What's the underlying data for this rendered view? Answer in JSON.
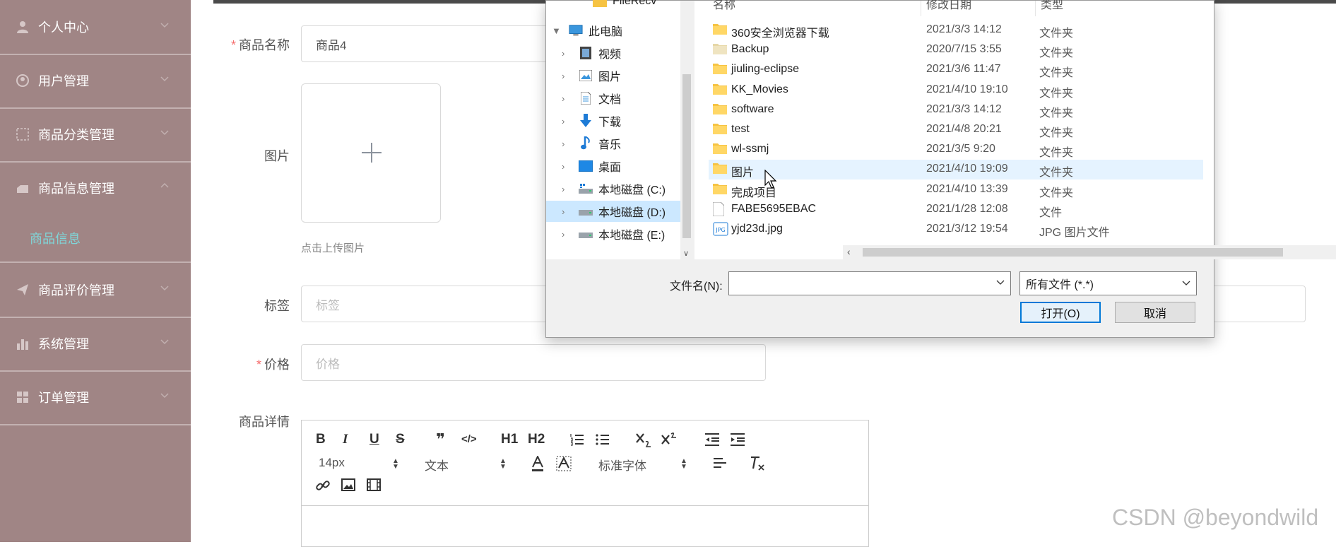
{
  "sidebar": {
    "items": [
      {
        "label": "个人中心",
        "icon": "user-icon"
      },
      {
        "label": "用户管理",
        "icon": "users-icon"
      },
      {
        "label": "商品分类管理",
        "icon": "category-icon"
      },
      {
        "label": "商品信息管理",
        "icon": "product-icon"
      },
      {
        "label": "商品评价管理",
        "icon": "review-icon"
      },
      {
        "label": "系统管理",
        "icon": "chart-icon"
      },
      {
        "label": "订单管理",
        "icon": "order-icon"
      }
    ],
    "active_sub": "商品信息"
  },
  "form": {
    "name_label": "商品名称",
    "name_value": "商品4",
    "image_label": "图片",
    "upload_hint": "点击上传图片",
    "tag_label": "标签",
    "tag_placeholder": "标签",
    "price_label": "价格",
    "price_placeholder": "价格",
    "detail_label": "商品详情"
  },
  "editor": {
    "font_size": "14px",
    "block_type": "文本",
    "font_family": "标准字体",
    "buttons": [
      "B",
      "I",
      "U",
      "S",
      "❞",
      "</>",
      "H1",
      "H2"
    ]
  },
  "dialog": {
    "tree_top": "FileRecv",
    "columns": {
      "name": "名称",
      "date": "修改日期",
      "type": "类型"
    },
    "tree": [
      {
        "label": "此电脑",
        "icon": "computer-icon"
      },
      {
        "label": "视频",
        "icon": "video-icon"
      },
      {
        "label": "图片",
        "icon": "picture-icon"
      },
      {
        "label": "文档",
        "icon": "document-icon"
      },
      {
        "label": "下载",
        "icon": "download-icon"
      },
      {
        "label": "音乐",
        "icon": "music-icon"
      },
      {
        "label": "桌面",
        "icon": "desktop-icon"
      },
      {
        "label": "本地磁盘 (C:)",
        "icon": "drive-icon"
      },
      {
        "label": "本地磁盘 (D:)",
        "icon": "drive-icon"
      },
      {
        "label": "本地磁盘 (E:)",
        "icon": "drive-icon"
      }
    ],
    "files": [
      {
        "name": "360安全浏览器下载",
        "date": "2021/3/3 14:12",
        "type": "文件夹",
        "kind": "folder"
      },
      {
        "name": "Backup",
        "date": "2020/7/15 3:55",
        "type": "文件夹",
        "kind": "folder-light"
      },
      {
        "name": "jiuling-eclipse",
        "date": "2021/3/6 11:47",
        "type": "文件夹",
        "kind": "folder"
      },
      {
        "name": "KK_Movies",
        "date": "2021/4/10 19:10",
        "type": "文件夹",
        "kind": "folder"
      },
      {
        "name": "software",
        "date": "2021/3/3 14:12",
        "type": "文件夹",
        "kind": "folder"
      },
      {
        "name": "test",
        "date": "2021/4/8 20:21",
        "type": "文件夹",
        "kind": "folder"
      },
      {
        "name": "wl-ssmj",
        "date": "2021/3/5 9:20",
        "type": "文件夹",
        "kind": "folder"
      },
      {
        "name": "图片",
        "date": "2021/4/10 19:09",
        "type": "文件夹",
        "kind": "folder"
      },
      {
        "name": "完成项目",
        "date": "2021/4/10 13:39",
        "type": "文件夹",
        "kind": "folder"
      },
      {
        "name": "FABE5695EBAC",
        "date": "2021/1/28 12:08",
        "type": "文件",
        "kind": "file"
      },
      {
        "name": "yjd23d.jpg",
        "date": "2021/3/12 19:54",
        "type": "JPG 图片文件",
        "kind": "jpg"
      }
    ],
    "filename_label": "文件名(N):",
    "filename_value": "",
    "filetype_value": "所有文件 (*.*)",
    "open_label": "打开(O)",
    "cancel_label": "取消"
  },
  "watermark": "CSDN @beyondwild",
  "colors": {
    "sidebar_bg": "#a08585",
    "sidebar_active": "#7fd6d9",
    "accent": "#0078d7"
  }
}
